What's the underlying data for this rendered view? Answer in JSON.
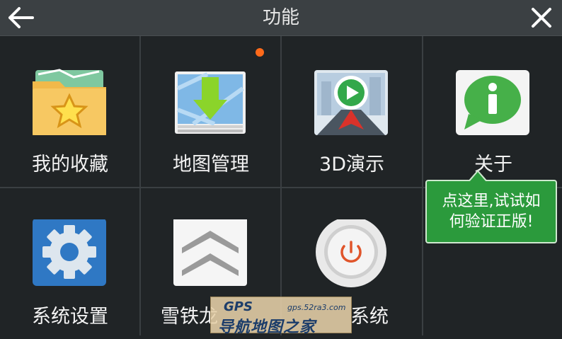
{
  "header": {
    "title": "功能"
  },
  "items": [
    {
      "label": "我的收藏",
      "icon": "favorites-folder-star-icon"
    },
    {
      "label": "地图管理",
      "icon": "map-download-icon",
      "badge": true
    },
    {
      "label": "3D演示",
      "icon": "3d-demo-play-icon"
    },
    {
      "label": "关于",
      "icon": "info-bubble-icon"
    },
    {
      "label": "系统设置",
      "icon": "gear-settings-icon"
    },
    {
      "label": "雪铁龙",
      "icon": "citroen-logo-icon"
    },
    {
      "label": "系统",
      "icon": "power-icon"
    }
  ],
  "tooltip": {
    "line1": "点这里,试试如",
    "line2": "何验证正版!"
  },
  "watermark": {
    "brand": "GPS",
    "url": "gps.52ra3.com",
    "text": "导航地图之家"
  },
  "colors": {
    "badge": "#ff6a1a",
    "tooltip_bg": "#2b9a3c",
    "header_bg": "#3b4043",
    "body_bg": "#202426"
  }
}
